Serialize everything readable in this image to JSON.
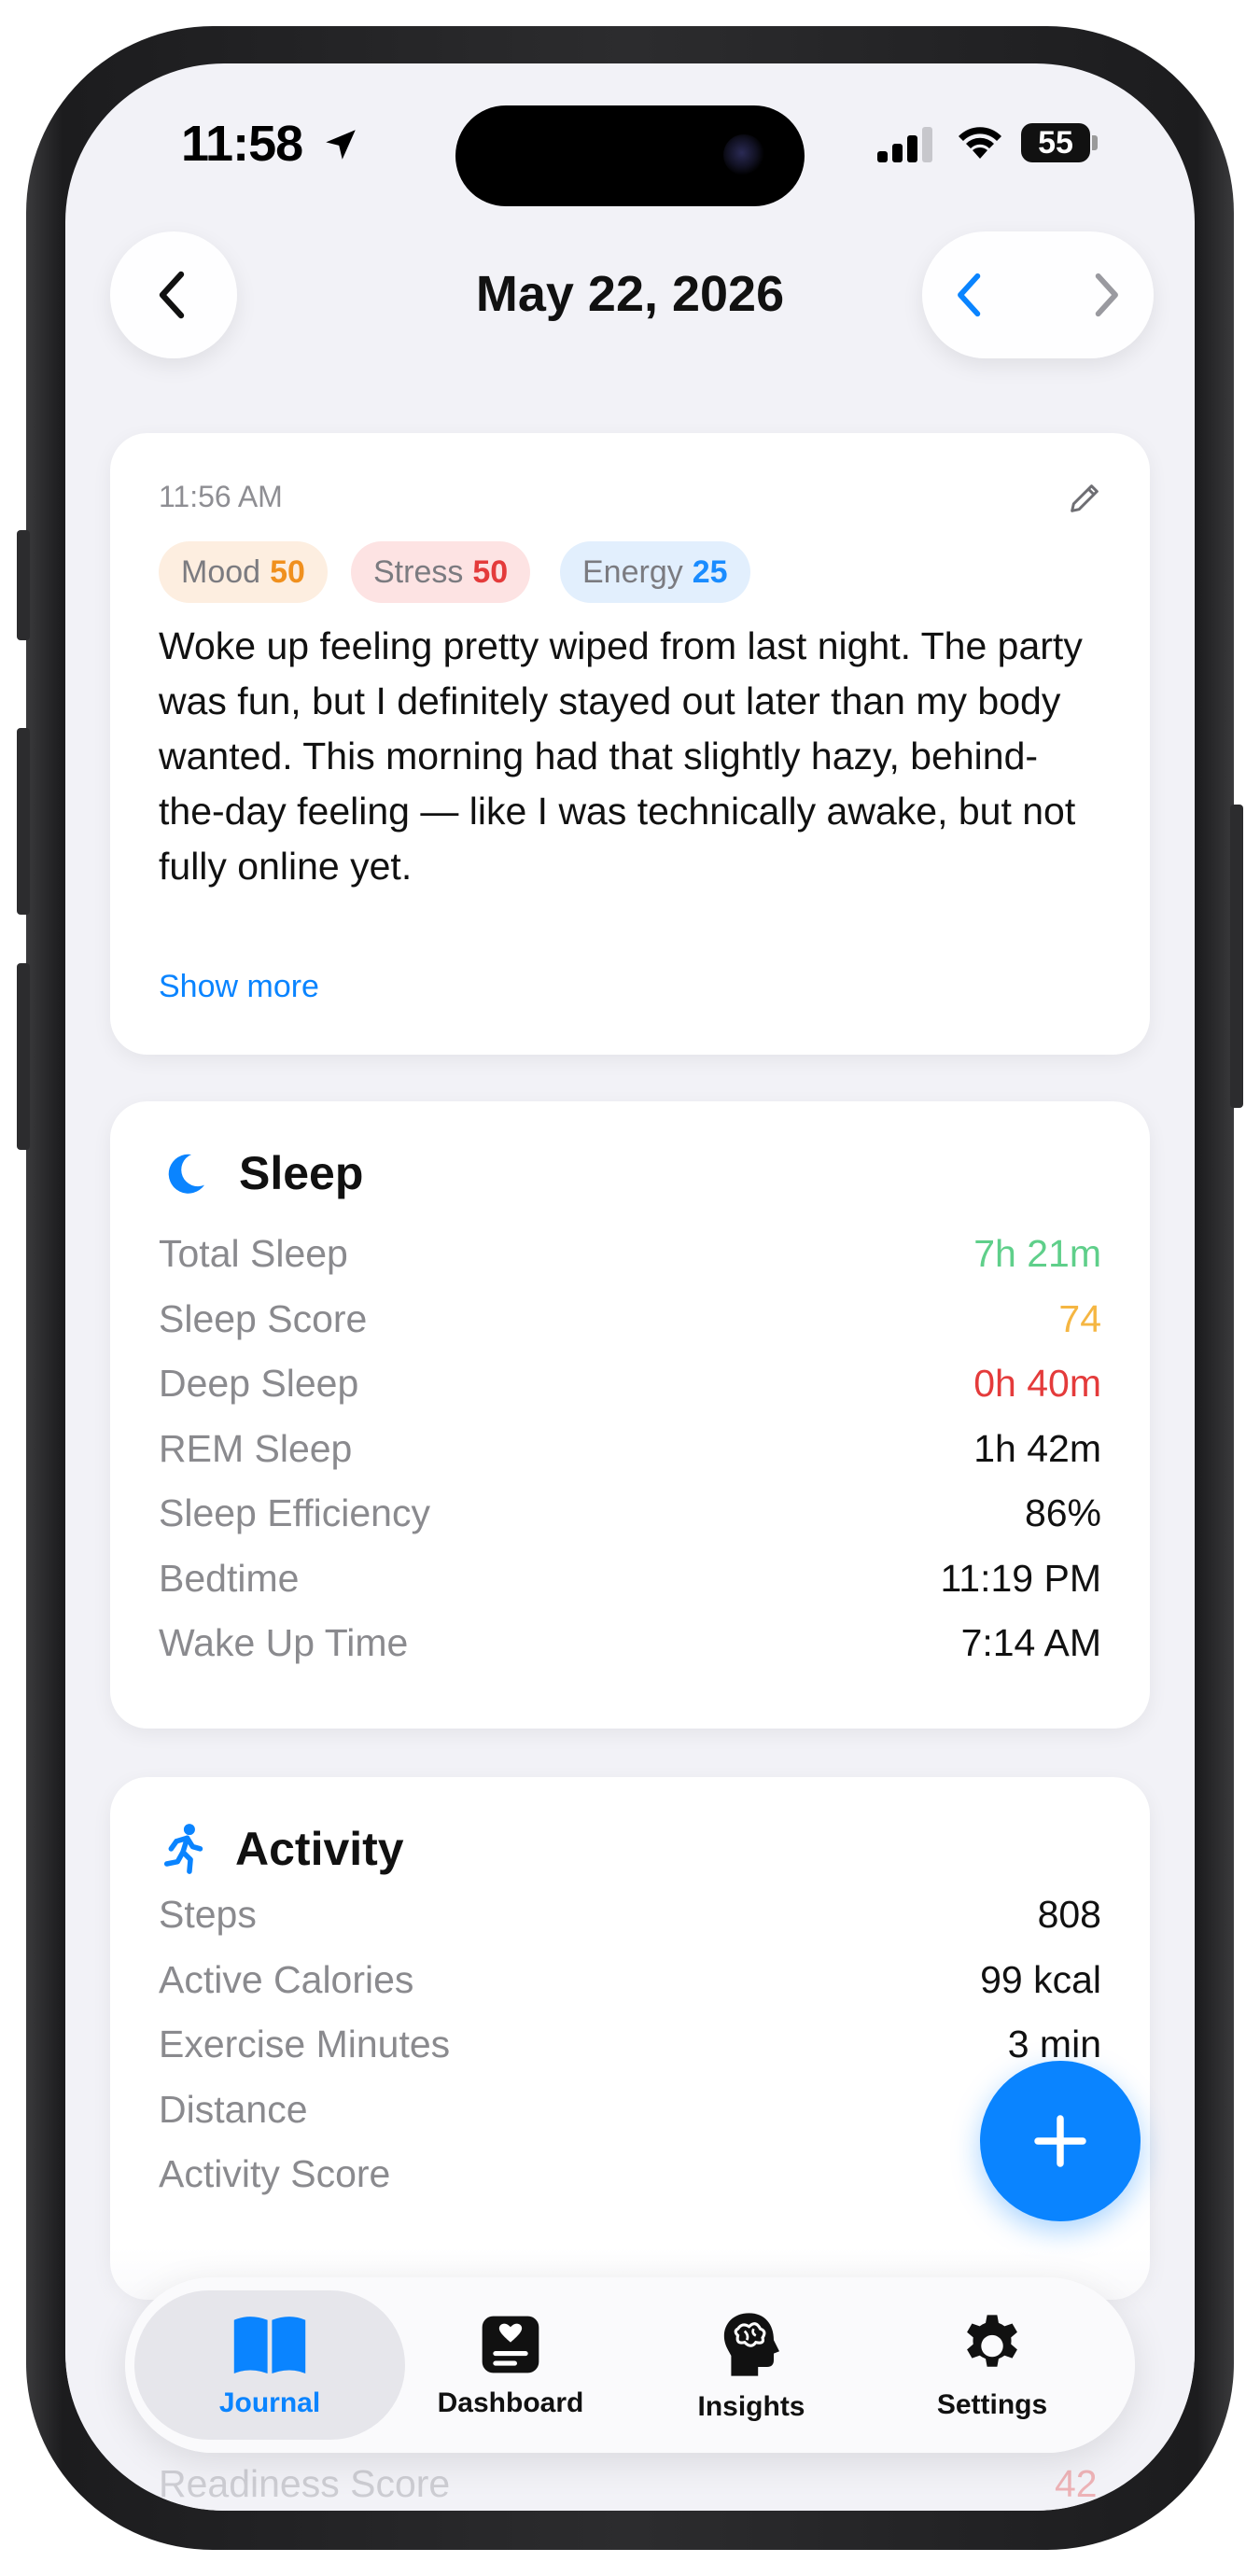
{
  "status_bar": {
    "time": "11:58",
    "battery": "55"
  },
  "header": {
    "title": "May 22, 2026"
  },
  "entry": {
    "time": "11:56 AM",
    "pills": [
      {
        "label": "Mood",
        "value": "50",
        "color": "#f0901e",
        "bg": "#fdeee0"
      },
      {
        "label": "Stress",
        "value": "50",
        "color": "#e43b3b",
        "bg": "#fde3e3"
      },
      {
        "label": "Energy",
        "value": "25",
        "color": "#1a8cff",
        "bg": "#e2effd"
      }
    ],
    "text": "Woke up feeling pretty wiped from last night. The party was fun, but I definitely stayed out later than my body wanted. This morning had that slightly hazy, behind-the-day feeling — like I was technically awake, but not fully online yet.",
    "show_more": "Show more"
  },
  "sleep": {
    "title": "Sleep",
    "rows": [
      {
        "label": "Total Sleep",
        "value": "7h 21m",
        "color": "#5fcf8a"
      },
      {
        "label": "Sleep Score",
        "value": "74",
        "color": "#f5b642"
      },
      {
        "label": "Deep Sleep",
        "value": "0h 40m",
        "color": "#e43b3b"
      },
      {
        "label": "REM Sleep",
        "value": "1h 42m",
        "color": "#111111"
      },
      {
        "label": "Sleep Efficiency",
        "value": "86%",
        "color": "#111111"
      },
      {
        "label": "Bedtime",
        "value": "11:19 PM",
        "color": "#111111"
      },
      {
        "label": "Wake Up Time",
        "value": "7:14 AM",
        "color": "#111111"
      }
    ]
  },
  "activity": {
    "title": "Activity",
    "rows": [
      {
        "label": "Steps",
        "value": "808",
        "color": "#111111"
      },
      {
        "label": "Active Calories",
        "value": "99 kcal",
        "color": "#111111"
      },
      {
        "label": "Exercise Minutes",
        "value": "3 min",
        "color": "#111111"
      },
      {
        "label": "Distance",
        "value": "",
        "color": "#111111"
      },
      {
        "label": "Activity Score",
        "value": "",
        "color": "#111111"
      }
    ]
  },
  "readiness_peek": {
    "label": "Readiness Score",
    "value": "42"
  },
  "tabs": [
    {
      "label": "Journal",
      "icon": "book-icon",
      "active": true
    },
    {
      "label": "Dashboard",
      "icon": "heart-card-icon",
      "active": false
    },
    {
      "label": "Insights",
      "icon": "brain-head-icon",
      "active": false
    },
    {
      "label": "Settings",
      "icon": "gear-icon",
      "active": false
    }
  ],
  "colors": {
    "accent": "#0a84ff",
    "background": "#f2f2f7"
  }
}
